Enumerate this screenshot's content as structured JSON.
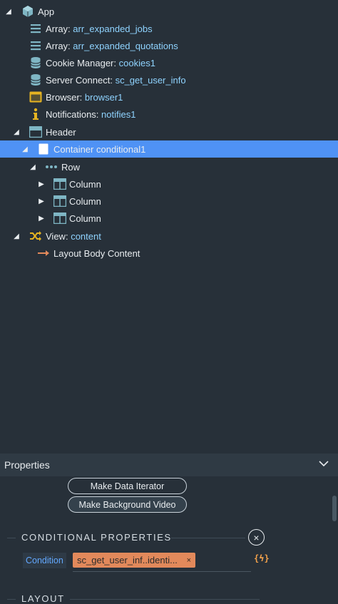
{
  "tree": {
    "app": "App",
    "arr1_prefix": "Array:",
    "arr1_value": "arr_expanded_jobs",
    "arr2_prefix": "Array:",
    "arr2_value": "arr_expanded_quotations",
    "cookie_prefix": "Cookie Manager:",
    "cookie_value": "cookies1",
    "server_prefix": "Server Connect:",
    "server_value": "sc_get_user_info",
    "browser_prefix": "Browser:",
    "browser_value": "browser1",
    "notif_prefix": "Notifications:",
    "notif_value": "notifies1",
    "header": "Header",
    "container": "Container conditional1",
    "row": "Row",
    "col1": "Column",
    "col2": "Column",
    "col3": "Column",
    "view_prefix": "View:",
    "view_value": "content",
    "layout_body": "Layout Body Content"
  },
  "properties": {
    "title": "Properties",
    "make_data_iterator": "Make Data Iterator",
    "make_background_video": "Make Background Video",
    "conditional_section": "CONDITIONAL PROPERTIES",
    "condition_label": "Condition",
    "condition_value": "sc_get_user_inf..identi...",
    "condition_remove": "×",
    "dynamic_icon_text": "{ϟ}",
    "layout_section": "LAYOUT"
  },
  "colors": {
    "panel_bg": "#273039",
    "selection": "#4f92f5",
    "value_text": "#8fd3ff",
    "tag_bg": "#e2895b"
  }
}
